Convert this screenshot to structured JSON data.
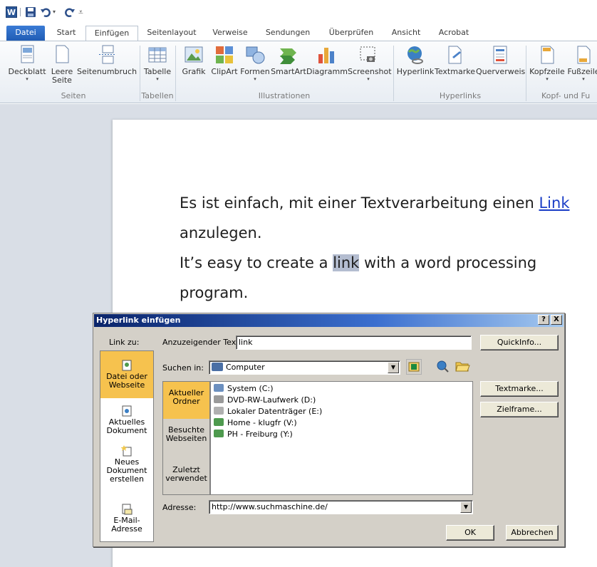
{
  "qat": {
    "app_letter": "W",
    "customize_glyph": "⩡"
  },
  "tabs": [
    {
      "label": "Datei"
    },
    {
      "label": "Start"
    },
    {
      "label": "Einfügen"
    },
    {
      "label": "Seitenlayout"
    },
    {
      "label": "Verweise"
    },
    {
      "label": "Sendungen"
    },
    {
      "label": "Überprüfen"
    },
    {
      "label": "Ansicht"
    },
    {
      "label": "Acrobat"
    }
  ],
  "ribbon": {
    "buttons": [
      {
        "label": "Deckblatt",
        "icon": "cover-page-icon"
      },
      {
        "label": "Leere Seite",
        "icon": "blank-page-icon"
      },
      {
        "label": "Seitenumbruch",
        "icon": "page-break-icon"
      },
      {
        "label": "Tabelle",
        "icon": "table-icon"
      },
      {
        "label": "Grafik",
        "icon": "picture-icon"
      },
      {
        "label": "ClipArt",
        "icon": "clipart-icon"
      },
      {
        "label": "Formen",
        "icon": "shapes-icon"
      },
      {
        "label": "SmartArt",
        "icon": "smartart-icon"
      },
      {
        "label": "Diagramm",
        "icon": "chart-icon"
      },
      {
        "label": "Screenshot",
        "icon": "screenshot-icon"
      },
      {
        "label": "Hyperlink",
        "icon": "hyperlink-icon"
      },
      {
        "label": "Textmarke",
        "icon": "bookmark-icon"
      },
      {
        "label": "Querverweis",
        "icon": "cross-reference-icon"
      },
      {
        "label": "Kopfzeile",
        "icon": "header-icon"
      },
      {
        "label": "Fußzeile",
        "icon": "footer-icon"
      }
    ],
    "groups": [
      "Seiten",
      "Tabellen",
      "Illustrationen",
      "Hyperlinks",
      "Kopf- und Fu"
    ]
  },
  "document": {
    "p1_text": "Es ist einfach, mit einer Textverarbeitung einen ",
    "p1_link": "Link",
    "p1_text2": "anzulegen.",
    "p2_before": "It’s easy to create a ",
    "p2_selected": "link",
    "p2_after": " with a word processing",
    "p2_text2": "program."
  },
  "dialog": {
    "title": "Hyperlink einfügen",
    "help_label": "?",
    "close_label": "X",
    "link_to_label": "Link zu:",
    "display_text_label": "Anzuzeigender Text:",
    "display_text_value": "link",
    "quickinfo_label": "QuickInfo...",
    "look_in_label": "Suchen in:",
    "look_in_value": "Computer",
    "bookmark_button": "Textmarke...",
    "target_frame_button": "Zielframe...",
    "address_label": "Adresse:",
    "address_value": "http://www.suchmaschine.de/",
    "ok_label": "OK",
    "cancel_label": "Abbrechen",
    "places": [
      {
        "label": "Datei oder Webseite",
        "icon": "file-web-icon"
      },
      {
        "label": "Aktuelles Dokument",
        "icon": "current-document-icon"
      },
      {
        "label": "Neues Dokument erstellen",
        "icon": "new-document-icon"
      },
      {
        "label": "E-Mail-Adresse",
        "icon": "email-icon"
      }
    ],
    "nav": [
      {
        "label": "Aktueller Ordner"
      },
      {
        "label": "Besuchte Webseiten"
      },
      {
        "label": "Zuletzt verwendet"
      }
    ],
    "files": [
      {
        "label": "System (C:)",
        "icon": "system-drive-icon",
        "color": "#6b8fbf"
      },
      {
        "label": "DVD-RW-Laufwerk (D:)",
        "icon": "dvd-drive-icon",
        "color": "#9a9a9a"
      },
      {
        "label": "Lokaler Datenträger (E:)",
        "icon": "local-drive-icon",
        "color": "#b0b0b0"
      },
      {
        "label": "Home - klugfr (V:)",
        "icon": "network-drive-icon",
        "color": "#4e9a4e"
      },
      {
        "label": "PH - Freiburg (Y:)",
        "icon": "network-drive-icon",
        "color": "#4e9a4e"
      }
    ]
  }
}
